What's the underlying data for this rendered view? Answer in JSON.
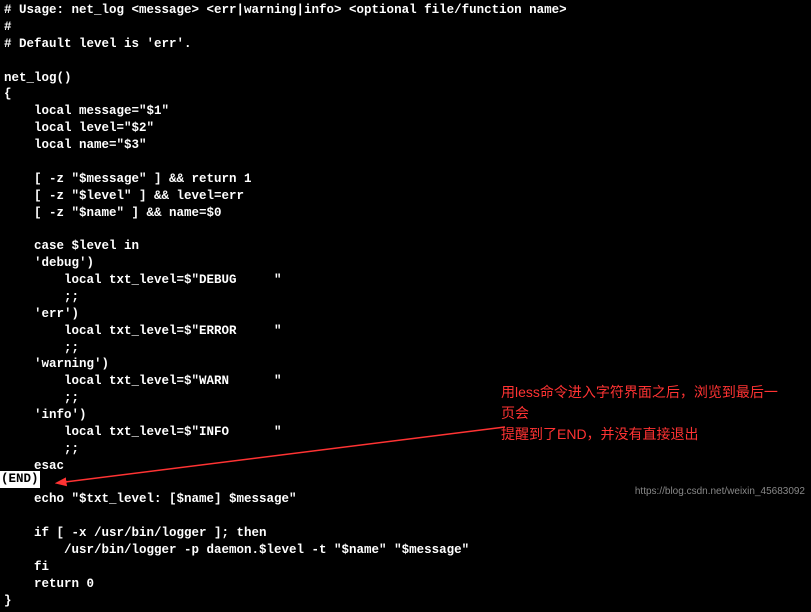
{
  "terminal": {
    "lines": [
      "# Usage: net_log <message> <err|warning|info> <optional file/function name>",
      "#",
      "# Default level is 'err'.",
      "",
      "net_log()",
      "{",
      "    local message=\"$1\"",
      "    local level=\"$2\"",
      "    local name=\"$3\"",
      "",
      "    [ -z \"$message\" ] && return 1",
      "    [ -z \"$level\" ] && level=err",
      "    [ -z \"$name\" ] && name=$0",
      "",
      "    case $level in",
      "    'debug')",
      "        local txt_level=$\"DEBUG     \"",
      "        ;;",
      "    'err')",
      "        local txt_level=$\"ERROR     \"",
      "        ;;",
      "    'warning')",
      "        local txt_level=$\"WARN      \"",
      "        ;;",
      "    'info')",
      "        local txt_level=$\"INFO      \"",
      "        ;;",
      "    esac",
      "",
      "    echo \"$txt_level: [$name] $message\"",
      "",
      "    if [ -x /usr/bin/logger ]; then",
      "        /usr/bin/logger -p daemon.$level -t \"$name\" \"$message\"",
      "    fi",
      "    return 0",
      "}"
    ],
    "end_marker": "(END)"
  },
  "annotation": {
    "line1": "用less命令进入字符界面之后，浏览到最后一页会",
    "line2": "提醒到了END，并没有直接退出"
  },
  "watermark": "https://blog.csdn.net/weixin_45683092"
}
